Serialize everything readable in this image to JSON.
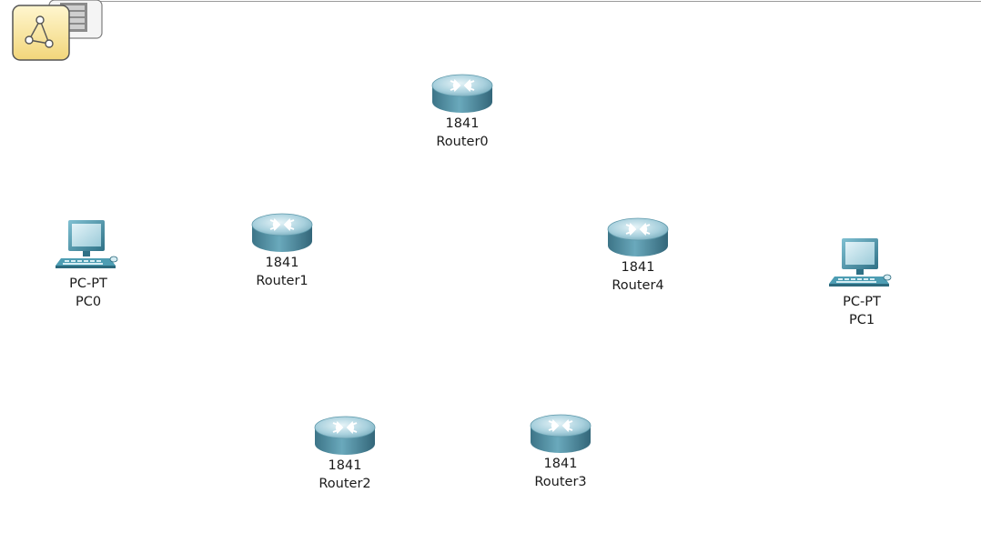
{
  "toolbar": {
    "logical_view_icon": "logical-topology-icon",
    "cluster_icon": "cluster-device-icon"
  },
  "devices": {
    "router0": {
      "model": "1841",
      "name": "Router0",
      "icon": "router-icon"
    },
    "router1": {
      "model": "1841",
      "name": "Router1",
      "icon": "router-icon"
    },
    "router2": {
      "model": "1841",
      "name": "Router2",
      "icon": "router-icon"
    },
    "router3": {
      "model": "1841",
      "name": "Router3",
      "icon": "router-icon"
    },
    "router4": {
      "model": "1841",
      "name": "Router4",
      "icon": "router-icon"
    },
    "pc0": {
      "model": "PC-PT",
      "name": "PC0",
      "icon": "pc-icon"
    },
    "pc1": {
      "model": "PC-PT",
      "name": "PC1",
      "icon": "pc-icon"
    }
  },
  "colors": {
    "router_top": "#b9dbe6",
    "router_side": "#4f8fa3",
    "pc_screen": "#a9d3df",
    "pc_body": "#3f8aa0",
    "toolbar_yellow": "#fbe9a7"
  }
}
